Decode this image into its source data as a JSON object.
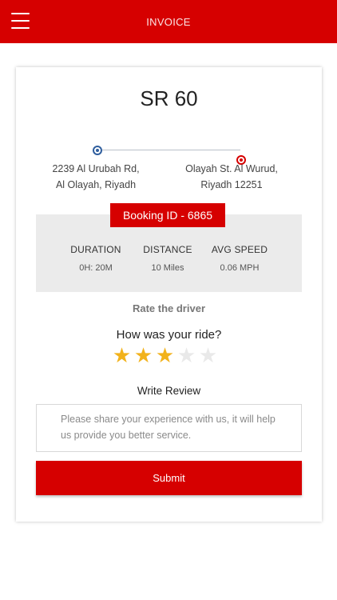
{
  "header": {
    "title": "INVOICE",
    "menu_icon": "hamburger-menu-icon",
    "color": "#d60000"
  },
  "invoice": {
    "amount": "SR 60",
    "from_line1": "2239 Al Urubah Rd,",
    "from_line2": "Al Olayah, Riyadh",
    "to_line1": "Olayah St. Al Wurud,",
    "to_line2": "Riyadh 12251",
    "booking_id": "Booking ID - 6865",
    "stats": [
      {
        "label": "DURATION",
        "value": "0H: 20M"
      },
      {
        "label": "DISTANCE",
        "value": "10 Miles"
      },
      {
        "label": "AVG SPEED",
        "value": "0.06 MPH"
      }
    ]
  },
  "rating": {
    "heading": "Rate the driver",
    "question": "How was your ride?",
    "stars_filled": 3,
    "stars_total": 5,
    "star_color": "#f2b21b"
  },
  "review": {
    "heading": "Write Review",
    "placeholder": "Please share your experience with us, it will help us provide you better service.",
    "submit_label": "Submit"
  }
}
